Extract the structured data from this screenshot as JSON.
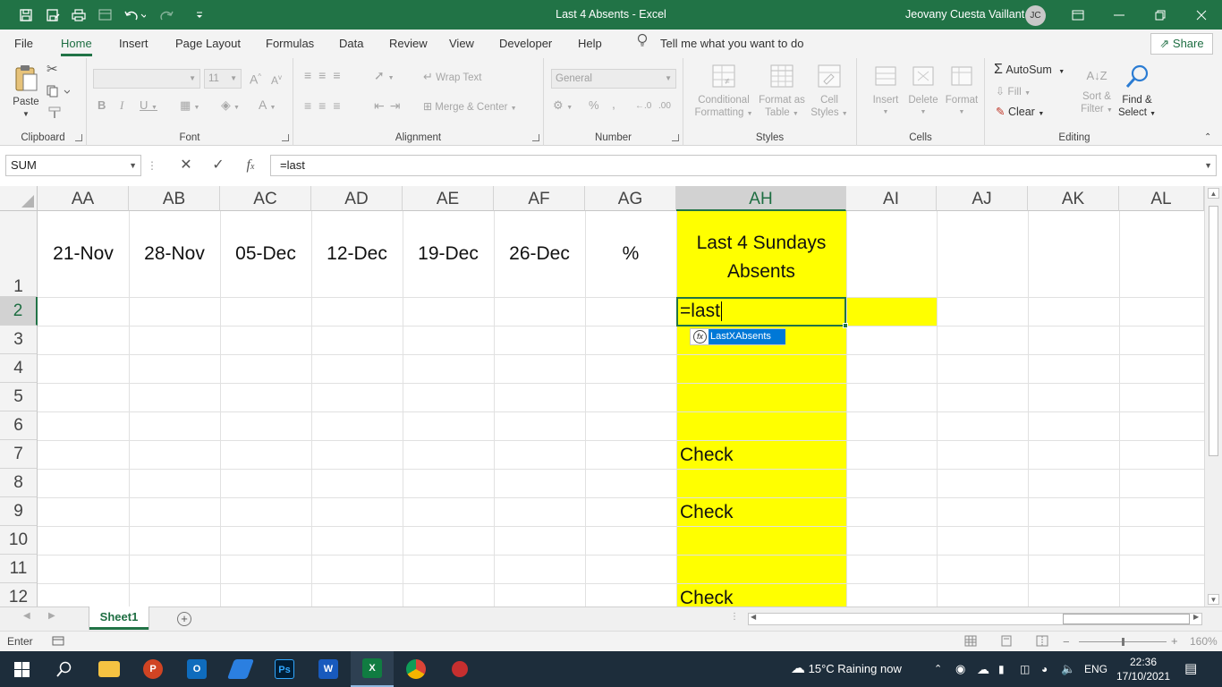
{
  "window": {
    "title": "Last 4 Absents  -  Excel",
    "user_name": "Jeovany Cuesta Vaillant",
    "user_initials": "JC"
  },
  "tabs": [
    "File",
    "Home",
    "Insert",
    "Page Layout",
    "Formulas",
    "Data",
    "Review",
    "View",
    "Developer",
    "Help"
  ],
  "active_tab": "Home",
  "tell_me": "Tell me what you want to do",
  "share_label": "Share",
  "ribbon": {
    "clipboard": {
      "label": "Clipboard",
      "paste": "Paste"
    },
    "font": {
      "label": "Font",
      "size": "11"
    },
    "alignment": {
      "label": "Alignment",
      "wrap_text": "Wrap Text",
      "merge_center": "Merge & Center"
    },
    "number": {
      "label": "Number",
      "format": "General"
    },
    "styles": {
      "label": "Styles",
      "conditional": [
        "Conditional",
        "Formatting"
      ],
      "format_table": [
        "Format as",
        "Table"
      ],
      "cell_styles": [
        "Cell",
        "Styles"
      ]
    },
    "cells": {
      "label": "Cells",
      "insert": "Insert",
      "delete": "Delete",
      "format": "Format"
    },
    "editing": {
      "label": "Editing",
      "autosum": "AutoSum",
      "fill": "Fill",
      "clear": "Clear",
      "sort_filter": [
        "Sort &",
        "Filter"
      ],
      "find_select": [
        "Find &",
        "Select"
      ]
    }
  },
  "formula_bar": {
    "name_box": "SUM",
    "formula": "=last"
  },
  "grid": {
    "columns": [
      "AA",
      "AB",
      "AC",
      "AD",
      "AE",
      "AF",
      "AG",
      "AH",
      "AI",
      "AJ",
      "AK",
      "AL"
    ],
    "selected_column": "AH",
    "rows": [
      "1",
      "2",
      "3",
      "4",
      "5",
      "6",
      "7",
      "8",
      "9",
      "10",
      "11",
      "12"
    ],
    "selected_row": "2",
    "row1": [
      "21-Nov",
      "28-Nov",
      "05-Dec",
      "12-Dec",
      "19-Dec",
      "26-Dec",
      "%"
    ],
    "header_line1": "Last 4 Sundays",
    "header_line2": "Absents",
    "editing_text": "=last",
    "autocomplete": "LastXAbsents",
    "checks": [
      {
        "row": "7",
        "text": "Check"
      },
      {
        "row": "9",
        "text": "Check"
      },
      {
        "row": "12",
        "text": "Check"
      }
    ],
    "highlight_color": "#FFFF00"
  },
  "sheets": [
    "Sheet1"
  ],
  "active_sheet": "Sheet1",
  "status": {
    "mode": "Enter",
    "zoom": "160%"
  },
  "taskbar": {
    "weather": "15°C  Raining now",
    "language": "ENG",
    "time": "22:36",
    "date": "17/10/2021"
  },
  "colors": {
    "excel_green": "#217346",
    "selection_blue": "#0078D7"
  }
}
